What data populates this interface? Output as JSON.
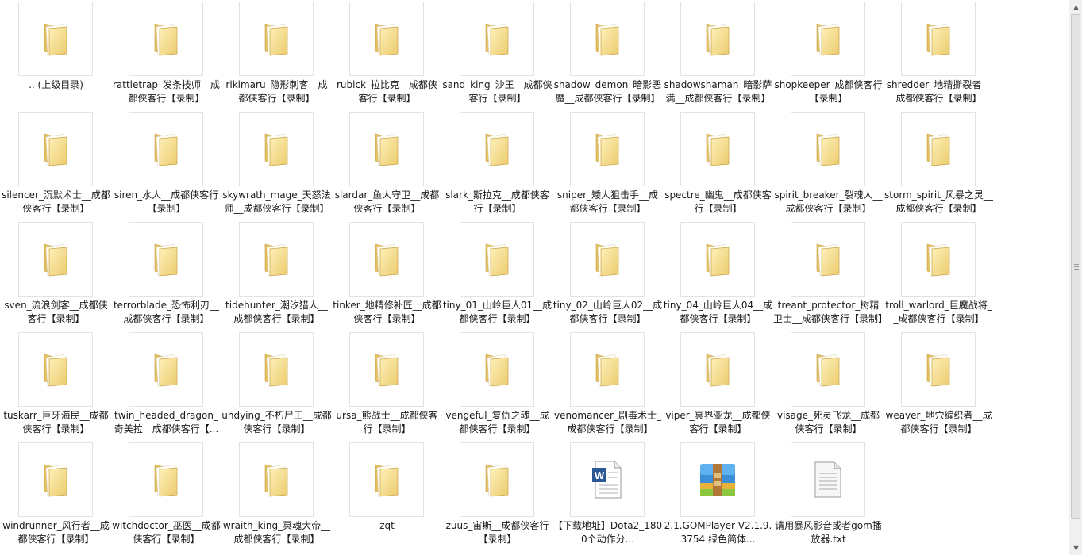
{
  "items": [
    {
      "type": "folder",
      "label": ".. (上级目录)"
    },
    {
      "type": "folder",
      "label": "rattletrap_发条技师__成都侠客行【录制】"
    },
    {
      "type": "folder",
      "label": "rikimaru_隐形刺客__成都侠客行【录制】"
    },
    {
      "type": "folder",
      "label": "rubick_拉比克__成都侠客行【录制】"
    },
    {
      "type": "folder",
      "label": "sand_king_沙王__成都侠客行【录制】"
    },
    {
      "type": "folder",
      "label": "shadow_demon_暗影恶魔__成都侠客行【录制】"
    },
    {
      "type": "folder",
      "label": "shadowshaman_暗影萨满__成都侠客行【录制】"
    },
    {
      "type": "folder",
      "label": "shopkeeper_成都侠客行【录制】"
    },
    {
      "type": "folder",
      "label": "shredder_地精撕裂者__成都侠客行【录制】"
    },
    {
      "type": "folder",
      "label": "silencer_沉默术士__成都侠客行【录制】"
    },
    {
      "type": "folder",
      "label": "siren_水人__成都侠客行【录制】"
    },
    {
      "type": "folder",
      "label": "skywrath_mage_天怒法师__成都侠客行【录制】"
    },
    {
      "type": "folder",
      "label": "slardar_鱼人守卫__成都侠客行【录制】"
    },
    {
      "type": "folder",
      "label": "slark_斯拉克__成都侠客行【录制】"
    },
    {
      "type": "folder",
      "label": "sniper_矮人狙击手__成都侠客行【录制】"
    },
    {
      "type": "folder",
      "label": "spectre_幽鬼__成都侠客行【录制】"
    },
    {
      "type": "folder",
      "label": "spirit_breaker_裂魂人__成都侠客行【录制】"
    },
    {
      "type": "folder",
      "label": "storm_spirit_风暴之灵__成都侠客行【录制】"
    },
    {
      "type": "folder",
      "label": "sven_流浪剑客__成都侠客行【录制】"
    },
    {
      "type": "folder",
      "label": "terrorblade_恐怖利刃__成都侠客行【录制】"
    },
    {
      "type": "folder",
      "label": "tidehunter_潮汐猎人__成都侠客行【录制】"
    },
    {
      "type": "folder",
      "label": "tinker_地精修补匠__成都侠客行【录制】"
    },
    {
      "type": "folder",
      "label": "tiny_01_山岭巨人01__成都侠客行【录制】"
    },
    {
      "type": "folder",
      "label": "tiny_02_山岭巨人02__成都侠客行【录制】"
    },
    {
      "type": "folder",
      "label": "tiny_04_山岭巨人04__成都侠客行【录制】"
    },
    {
      "type": "folder",
      "label": "treant_protector_树精卫士__成都侠客行【录制】"
    },
    {
      "type": "folder",
      "label": "troll_warlord_巨魔战将__成都侠客行【录制】"
    },
    {
      "type": "folder",
      "label": "tuskarr_巨牙海民__成都侠客行【录制】"
    },
    {
      "type": "folder",
      "label": "twin_headed_dragon_奇美拉__成都侠客行【..."
    },
    {
      "type": "folder",
      "label": "undying_不朽尸王__成都侠客行【录制】"
    },
    {
      "type": "folder",
      "label": "ursa_熊战士__成都侠客行【录制】"
    },
    {
      "type": "folder",
      "label": "vengeful_复仇之魂__成都侠客行【录制】"
    },
    {
      "type": "folder",
      "label": "venomancer_剧毒术士__成都侠客行【录制】"
    },
    {
      "type": "folder",
      "label": "viper_冥界亚龙__成都侠客行【录制】"
    },
    {
      "type": "folder",
      "label": "visage_死灵飞龙__成都侠客行【录制】"
    },
    {
      "type": "folder",
      "label": "weaver_地穴编织者__成都侠客行【录制】"
    },
    {
      "type": "folder",
      "label": "windrunner_风行者__成都侠客行【录制】"
    },
    {
      "type": "folder",
      "label": "witchdoctor_巫医__成都侠客行【录制】"
    },
    {
      "type": "folder",
      "label": "wraith_king_冥魂大帝__成都侠客行【录制】"
    },
    {
      "type": "folder",
      "label": "zqt"
    },
    {
      "type": "folder",
      "label": "zuus_宙斯__成都侠客行【录制】"
    },
    {
      "type": "doc",
      "label": "【下载地址】Dota2_1800个动作分..."
    },
    {
      "type": "archive",
      "label": "2.1.GOMPlayer V2.1.9.3754 绿色简体..."
    },
    {
      "type": "txt",
      "label": "请用暴风影音或者gom播放器.txt"
    }
  ],
  "icons": {
    "folder": "folder-icon",
    "doc": "word-document-icon",
    "archive": "winrar-archive-icon",
    "txt": "text-file-icon"
  },
  "colors": {
    "folder_light": "#fbe9a8",
    "folder_dark": "#e8c66a",
    "word_blue": "#2b5797",
    "selection_border": "#e3e3e3"
  }
}
